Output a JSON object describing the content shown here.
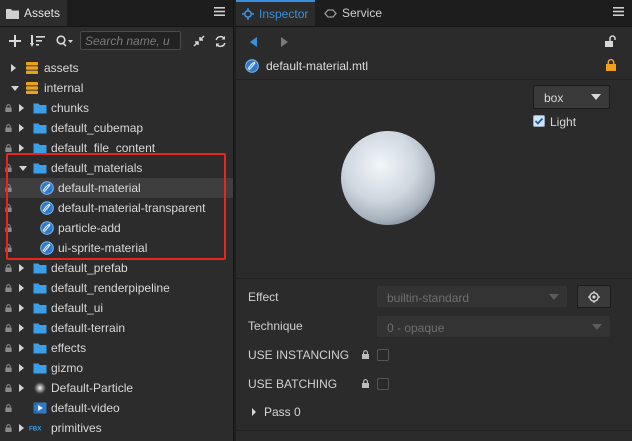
{
  "assets_panel": {
    "tab_label": "Assets",
    "search_placeholder": "Search name, u",
    "tree": [
      {
        "label": "assets",
        "kind": "db",
        "expanded": false,
        "lock": false
      },
      {
        "label": "internal",
        "kind": "db",
        "expanded": true,
        "lock": false
      },
      {
        "label": "chunks",
        "kind": "folder",
        "expanded": false,
        "lock": true
      },
      {
        "label": "default_cubemap",
        "kind": "folder",
        "expanded": false,
        "lock": true
      },
      {
        "label": "default_file_content",
        "kind": "folder",
        "expanded": false,
        "lock": true
      },
      {
        "label": "default_materials",
        "kind": "folder",
        "expanded": true,
        "lock": true
      },
      {
        "label": "default-material",
        "kind": "material",
        "lock": true,
        "selected": true
      },
      {
        "label": "default-material-transparent",
        "kind": "material",
        "lock": true
      },
      {
        "label": "particle-add",
        "kind": "material",
        "lock": true
      },
      {
        "label": "ui-sprite-material",
        "kind": "material",
        "lock": true
      },
      {
        "label": "default_prefab",
        "kind": "folder",
        "expanded": false,
        "lock": true
      },
      {
        "label": "default_renderpipeline",
        "kind": "folder",
        "expanded": false,
        "lock": true
      },
      {
        "label": "default_ui",
        "kind": "folder",
        "expanded": false,
        "lock": true
      },
      {
        "label": "default-terrain",
        "kind": "folder",
        "expanded": false,
        "lock": true
      },
      {
        "label": "effects",
        "kind": "folder",
        "expanded": false,
        "lock": true
      },
      {
        "label": "gizmo",
        "kind": "folder",
        "expanded": false,
        "lock": true
      },
      {
        "label": "Default-Particle",
        "kind": "particle",
        "expanded": false,
        "lock": true
      },
      {
        "label": "default-video",
        "kind": "video",
        "lock": true
      },
      {
        "label": "primitives",
        "kind": "fbx",
        "expanded": false,
        "lock": true
      }
    ],
    "fbx_badge": "FBX"
  },
  "inspector_panel": {
    "tab_inspector": "Inspector",
    "tab_service": "Service",
    "file_name": "default-material.mtl",
    "preview_shape": "box",
    "light_label": "Light",
    "light_checked": true,
    "effect_label": "Effect",
    "effect_value": "builtin-standard",
    "technique_label": "Technique",
    "technique_value": "0 - opaque",
    "use_instancing_label": "USE INSTANCING",
    "use_batching_label": "USE BATCHING",
    "pass_label": "Pass 0"
  },
  "colors": {
    "accent_blue": "#3b8fe0",
    "highlight_red": "#e8261c",
    "lock_orange": "#f0a020",
    "folder_blue": "#3a9ee8"
  }
}
